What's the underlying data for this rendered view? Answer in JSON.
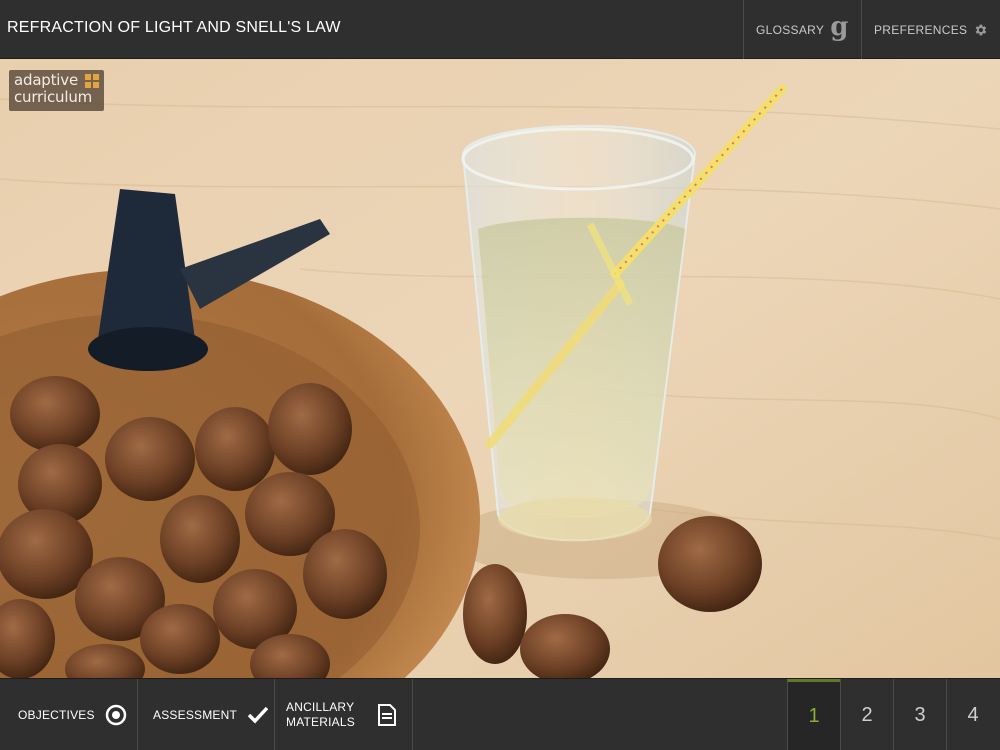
{
  "header": {
    "title": "REFRACTION OF LIGHT AND SNELL'S LAW",
    "glossary_label": "GLOSSARY",
    "glossary_icon": "g",
    "preferences_label": "PREFERENCES"
  },
  "logo": {
    "line1": "adaptive",
    "line2": "curriculum"
  },
  "footer": {
    "objectives_label": "OBJECTIVES",
    "assessment_label": "ASSESSMENT",
    "ancillary_line1": "ANCILLARY",
    "ancillary_line2": "MATERIALS",
    "pages": [
      "1",
      "2",
      "3",
      "4"
    ],
    "active_page": "1"
  },
  "colors": {
    "accent": "#8faa3a",
    "bar": "#2f2f2f"
  }
}
